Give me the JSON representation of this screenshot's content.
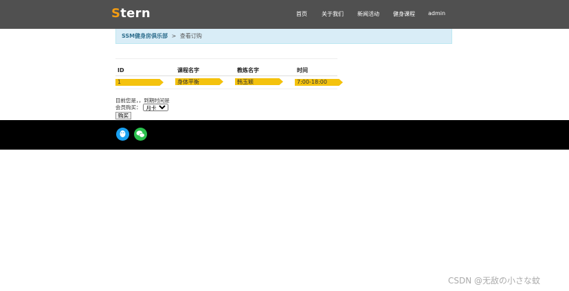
{
  "navbar": {
    "logo_first": "S",
    "logo_rest": "tern",
    "items": [
      {
        "label": "首页"
      },
      {
        "label": "关于我们"
      },
      {
        "label": "新闻活动"
      },
      {
        "label": "健身课程"
      },
      {
        "label": "admin"
      }
    ]
  },
  "breadcrumb": {
    "home": "SSM健身房俱乐部",
    "separator": ">",
    "current": "查看订购"
  },
  "table": {
    "headers": [
      "ID",
      "课程名字",
      "教练名字",
      "时间"
    ],
    "rows": [
      [
        "1",
        "身体平衡",
        "韩玉颖",
        "7:00-18:00"
      ]
    ]
  },
  "membership": {
    "info": "目前您是，，到期时间是",
    "buy_label": "会员购买：",
    "selected_option": "月卡",
    "buy_button": "购买"
  },
  "footer": {
    "icons": [
      "qq-icon",
      "wechat-icon"
    ]
  },
  "watermark": "CSDN @无敌の小さな蚊",
  "colors": {
    "navbar_bg": "#505050",
    "logo_accent": "#f39c12",
    "breadcrumb_bg": "#d9edf7",
    "highlight": "#f4c20d",
    "footer_bg": "#000000",
    "qq": "#1aa0f0",
    "wechat": "#2ac14d"
  }
}
